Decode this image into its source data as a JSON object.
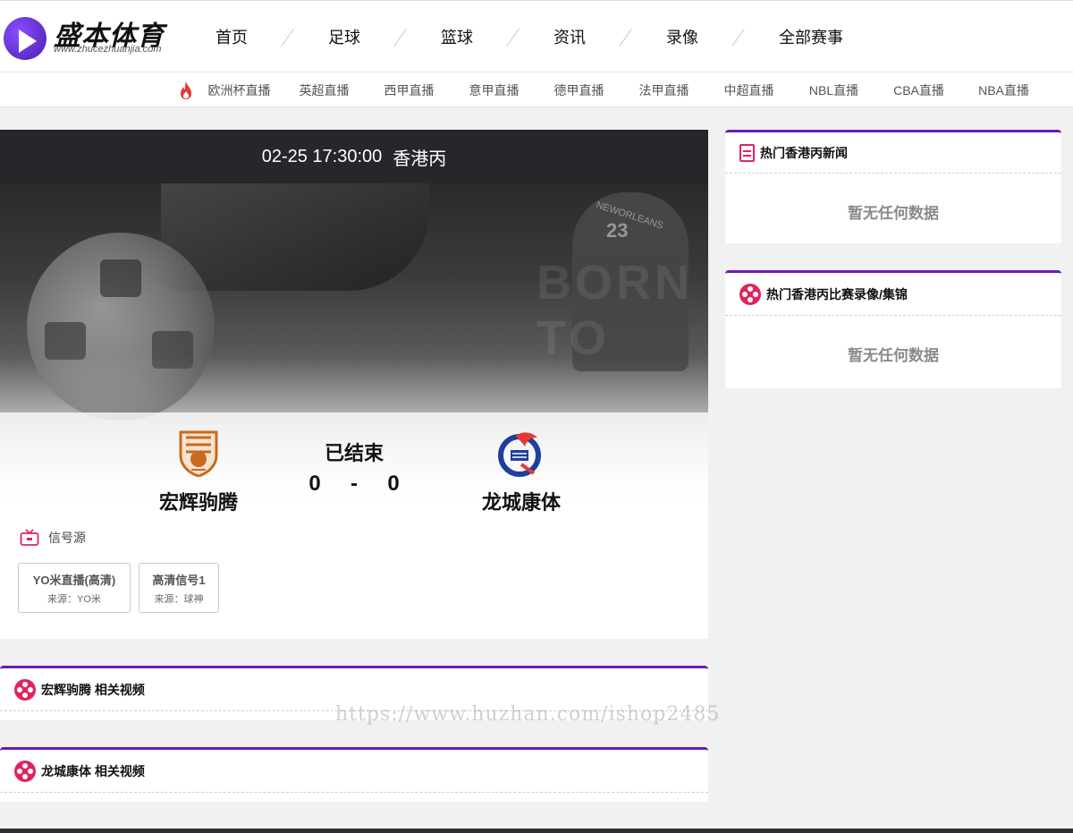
{
  "logo": {
    "title": "盛本体育",
    "url": "www.zhucezhuanjia.com"
  },
  "nav": [
    "首页",
    "足球",
    "篮球",
    "资讯",
    "录像",
    "全部赛事"
  ],
  "subnav": [
    "欧洲杯直播",
    "英超直播",
    "西甲直播",
    "意甲直播",
    "德甲直播",
    "法甲直播",
    "中超直播",
    "NBL直播",
    "CBA直播",
    "NBA直播"
  ],
  "match": {
    "datetime": "02-25 17:30:00",
    "league": "香港丙",
    "status": "已结束",
    "home": {
      "name": "宏辉驹腾",
      "score": "0"
    },
    "away": {
      "name": "龙城康体",
      "score": "0"
    },
    "separator": "-"
  },
  "signal": {
    "title": "信号源",
    "sources": [
      {
        "name": "YO米直播(高清)",
        "from": "来源：YO米"
      },
      {
        "name": "高清信号1",
        "from": "来源：球神"
      }
    ]
  },
  "related": [
    {
      "title": "宏辉驹腾 相关视频"
    },
    {
      "title": "龙城康体 相关视频"
    }
  ],
  "sidebar": {
    "news": {
      "title": "热门香港丙新闻",
      "empty": "暂无任何数据"
    },
    "videos": {
      "title": "热门香港丙比赛录像/集锦",
      "empty": "暂无任何数据"
    }
  },
  "hero_art": {
    "jersey_top": "NEWORLEANS",
    "jersey_number": "23",
    "slogan": "BORN TO"
  },
  "watermark": "https://www.huzhan.com/ishop2485",
  "colors": {
    "accent": "#6a1bb6",
    "icon": "#e0245e",
    "header_dark": "#25272a"
  }
}
